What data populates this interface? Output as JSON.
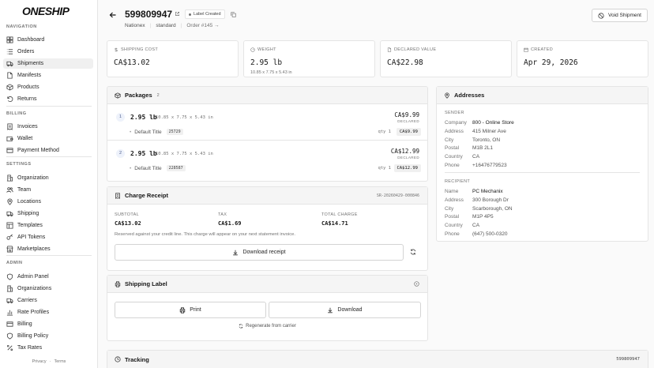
{
  "app": {
    "logo": "ONESHIP"
  },
  "sidebar": {
    "sections": [
      {
        "title": "NAVIGATION",
        "items": [
          {
            "label": "Dashboard",
            "icon": "grid-icon"
          },
          {
            "label": "Orders",
            "icon": "list-icon"
          },
          {
            "label": "Shipments",
            "icon": "truck-icon",
            "active": true
          },
          {
            "label": "Manifests",
            "icon": "document-icon"
          },
          {
            "label": "Products",
            "icon": "box-icon"
          },
          {
            "label": "Returns",
            "icon": "return-icon"
          }
        ]
      },
      {
        "title": "BILLING",
        "items": [
          {
            "label": "Invoices",
            "icon": "invoice-icon"
          },
          {
            "label": "Wallet",
            "icon": "wallet-icon"
          },
          {
            "label": "Payment Method",
            "icon": "card-icon"
          }
        ]
      },
      {
        "title": "SETTINGS",
        "items": [
          {
            "label": "Organization",
            "icon": "building-icon"
          },
          {
            "label": "Team",
            "icon": "users-icon"
          },
          {
            "label": "Locations",
            "icon": "location-icon"
          },
          {
            "label": "Shipping",
            "icon": "truck-icon"
          },
          {
            "label": "Templates",
            "icon": "template-icon"
          },
          {
            "label": "API Tokens",
            "icon": "key-icon"
          },
          {
            "label": "Marketplaces",
            "icon": "store-icon"
          }
        ]
      },
      {
        "title": "ADMIN",
        "items": [
          {
            "label": "Admin Panel",
            "icon": "shield-icon"
          },
          {
            "label": "Organizations",
            "icon": "building-icon"
          },
          {
            "label": "Carriers",
            "icon": "truck-icon"
          },
          {
            "label": "Rate Profiles",
            "icon": "chart-icon"
          },
          {
            "label": "Billing",
            "icon": "card-icon"
          },
          {
            "label": "Billing Policy",
            "icon": "shield-icon"
          },
          {
            "label": "Tax Rates",
            "icon": "percent-icon"
          }
        ]
      }
    ],
    "footer": {
      "privacy": "Privacy",
      "dot": "·",
      "terms": "Terms"
    }
  },
  "header": {
    "shipment_number": "599809947",
    "status_badge": "Label Created",
    "carrier": "Nationex",
    "service": "standard",
    "order_link": "Order #145 →",
    "void_button": "Void Shipment"
  },
  "stats": [
    {
      "label": "SHIPPING COST",
      "value": "CA$13.02",
      "icon": "dollar-icon"
    },
    {
      "label": "WEIGHT",
      "value": "2.95 lb",
      "sub": "10.85 x 7.75 x 5.43 in",
      "icon": "weight-icon"
    },
    {
      "label": "DECLARED VALUE",
      "value": "CA$22.98",
      "icon": "document-icon"
    },
    {
      "label": "CREATED",
      "value": "Apr 29, 2026",
      "icon": "calendar-icon"
    }
  ],
  "packages": {
    "title": "Packages",
    "count": "2",
    "items": [
      {
        "num": "1",
        "weight": "2.95 lb",
        "dims": "10.85 x 7.75 x 5.43 in",
        "price": "CA$9.99",
        "declared": "DECLARED",
        "item_title": "Default Title",
        "sku": "25729",
        "qty": "qty 1",
        "item_price": "CA$9.99"
      },
      {
        "num": "2",
        "weight": "2.95 lb",
        "dims": "10.85 x 7.75 x 5.43 in",
        "price": "CA$12.99",
        "declared": "DECLARED",
        "item_title": "Default Title",
        "sku": "228587",
        "qty": "qty 1",
        "item_price": "CA$12.99"
      }
    ]
  },
  "receipt": {
    "title": "Charge Receipt",
    "ref": "SR-20260429-000846",
    "subtotal_label": "SUBTOTAL",
    "subtotal": "CA$13.02",
    "tax_label": "TAX",
    "tax": "CA$1.69",
    "total_label": "TOTAL CHARGE",
    "total": "CA$14.71",
    "note": "Reserved against your credit line. This charge will appear on your next statement invoice.",
    "download_button": "Download receipt"
  },
  "label": {
    "title": "Shipping Label",
    "print_button": "Print",
    "download_button": "Download",
    "regenerate": "Regenerate from carrier"
  },
  "tracking": {
    "title": "Tracking",
    "number": "599809947"
  },
  "addresses": {
    "title": "Addresses",
    "sender_label": "SENDER",
    "sender": [
      {
        "k": "Company",
        "v": "800 - Online Store"
      },
      {
        "k": "Address",
        "v": "415 Milner Ave"
      },
      {
        "k": "City",
        "v": "Toronto, ON"
      },
      {
        "k": "Postal",
        "v": "M1B 2L1"
      },
      {
        "k": "Country",
        "v": "CA"
      },
      {
        "k": "Phone",
        "v": "+16476779523"
      }
    ],
    "recipient_label": "RECIPIENT",
    "recipient": [
      {
        "k": "Name",
        "v": "PC Mechanix"
      },
      {
        "k": "Address",
        "v": "300 Borough Dr"
      },
      {
        "k": "City",
        "v": "Scarborough, ON"
      },
      {
        "k": "Postal",
        "v": "M1P 4P5"
      },
      {
        "k": "Country",
        "v": "CA"
      },
      {
        "k": "Phone",
        "v": "(647) 500-0320"
      }
    ]
  }
}
